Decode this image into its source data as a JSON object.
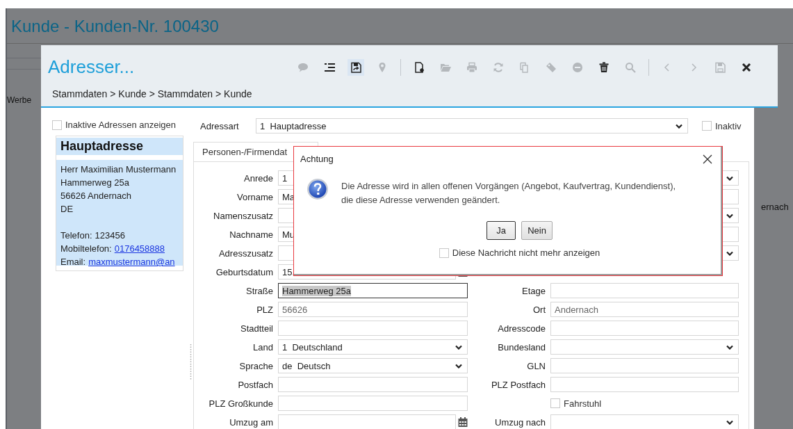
{
  "background": {
    "title": "Kunde - Kunden-Nr. 100430",
    "left_text": "Werbe",
    "right_text": "ernach"
  },
  "modal": {
    "title": "Adresser...",
    "breadcrumb": "Stammdaten > Kunde > Stammdaten > Kunde",
    "toolbar": [
      {
        "kind": "comment",
        "disabled": true,
        "hover": false
      },
      {
        "kind": "list",
        "disabled": false,
        "hover": false
      },
      {
        "kind": "save-as",
        "disabled": false,
        "hover": true
      },
      {
        "kind": "pin",
        "disabled": true,
        "hover": false
      },
      {
        "kind": "separator"
      },
      {
        "kind": "new",
        "disabled": false,
        "hover": false
      },
      {
        "kind": "folder",
        "disabled": true,
        "hover": false
      },
      {
        "kind": "print",
        "disabled": true,
        "hover": false
      },
      {
        "kind": "refresh",
        "disabled": true,
        "hover": false
      },
      {
        "kind": "copy",
        "disabled": true,
        "hover": false
      },
      {
        "kind": "tag",
        "disabled": true,
        "hover": false
      },
      {
        "kind": "minus",
        "disabled": true,
        "hover": false
      },
      {
        "kind": "trash",
        "disabled": false,
        "hover": false
      },
      {
        "kind": "search",
        "disabled": true,
        "hover": false
      },
      {
        "kind": "separator"
      },
      {
        "kind": "prev",
        "disabled": true,
        "hover": false
      },
      {
        "kind": "next",
        "disabled": true,
        "hover": false
      },
      {
        "kind": "save",
        "disabled": true,
        "hover": false
      },
      {
        "kind": "close",
        "disabled": false,
        "hover": false
      }
    ]
  },
  "left_panel": {
    "inactive_checkbox": {
      "label": "Inaktive Adressen anzeigen",
      "checked": false
    },
    "card": {
      "heading": "Hauptadresse",
      "address_lines": [
        "Herr Maximilian Mustermann",
        "Hammerweg 25a",
        "56626 Andernach",
        "DE"
      ],
      "contacts": [
        {
          "label": "Telefon:",
          "value": "123456",
          "link": false
        },
        {
          "label": "Mobiltelefon:",
          "value": "0176458888",
          "link": true
        },
        {
          "label": "Email:",
          "value": "maxmustermann@an",
          "link": true
        }
      ]
    }
  },
  "address_type": {
    "label": "Adressart",
    "value": "1  Hauptadresse"
  },
  "inactive": {
    "label": "Inaktiv",
    "checked": false
  },
  "tabs": [
    {
      "label": "Personen-/Firmendat",
      "selected": true
    }
  ],
  "form": {
    "rows": [
      {
        "left": {
          "label": "Anrede",
          "kind": "input",
          "value": "1"
        },
        "right": {
          "kind": "select"
        }
      },
      {
        "left": {
          "label": "Vorname",
          "kind": "input",
          "value": "Ma"
        },
        "right": {
          "kind": "input"
        }
      },
      {
        "left": {
          "label": "Namenszusatz",
          "kind": "input"
        },
        "right": {
          "kind": "select"
        }
      },
      {
        "left": {
          "label": "Nachname",
          "kind": "input",
          "value": "Mu"
        },
        "right": {
          "kind": "input"
        }
      },
      {
        "left": {
          "label": "Adresszusatz",
          "kind": "input"
        },
        "right": {
          "kind": "select"
        }
      },
      {
        "left": {
          "label": "Geburtsdatum",
          "kind": "date",
          "value": "15."
        }
      },
      {
        "left": {
          "label": "Straße",
          "kind": "input",
          "value": "Hammerweg 25a",
          "focused": true
        },
        "right": {
          "label": "Etage",
          "kind": "input"
        }
      },
      {
        "left": {
          "label": "PLZ",
          "kind": "input",
          "value": "56626",
          "readonly": true
        },
        "right": {
          "label": "Ort",
          "kind": "input",
          "value": "Andernach",
          "readonly": true
        }
      },
      {
        "left": {
          "label": "Stadtteil",
          "kind": "input"
        },
        "right": {
          "label": "Adresscode",
          "kind": "input"
        }
      },
      {
        "left": {
          "label": "Land",
          "kind": "select",
          "value": "1  Deutschland"
        },
        "right": {
          "label": "Bundesland",
          "kind": "select"
        }
      },
      {
        "left": {
          "label": "Sprache",
          "kind": "select",
          "value": "de  Deutsch"
        },
        "right": {
          "label": "GLN",
          "kind": "input"
        }
      },
      {
        "left": {
          "label": "Postfach",
          "kind": "input"
        },
        "right": {
          "label": "PLZ Postfach",
          "kind": "input"
        }
      },
      {
        "left": {
          "label": "PLZ Großkunde",
          "kind": "input"
        },
        "right": {
          "label": "Fahrstuhl",
          "kind": "checkbox",
          "checked": false
        }
      },
      {
        "left": {
          "label": "Umzug am",
          "kind": "date"
        },
        "right": {
          "label": "Umzug nach",
          "kind": "select"
        }
      }
    ]
  },
  "dialog": {
    "title": "Achtung",
    "message_lines": [
      "Die Adresse wird in allen offenen Vorgängen (Angebot, Kaufvertrag, Kundendienst),",
      "die diese Adresse verwenden geändert."
    ],
    "buttons": [
      {
        "label": "Ja",
        "focused": true
      },
      {
        "label": "Nein",
        "focused": false
      }
    ],
    "checkbox": {
      "label": "Diese Nachricht nicht mehr anzeigen",
      "checked": false
    }
  }
}
